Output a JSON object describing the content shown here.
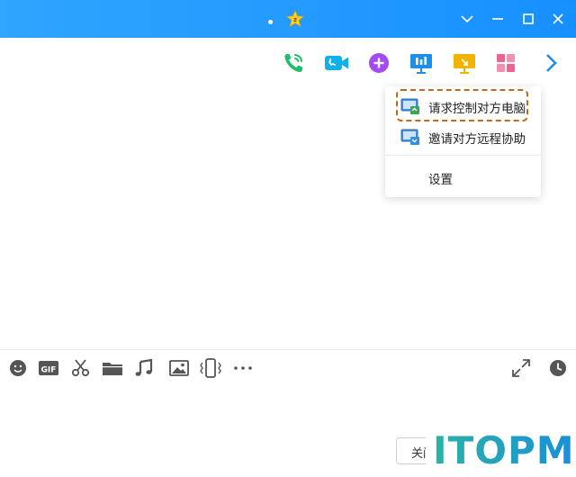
{
  "window": {
    "title_badge_icon": "star-icon",
    "controls": [
      "chevron-down-icon",
      "minimize-icon",
      "maximize-icon",
      "close-icon"
    ]
  },
  "action_bar": {
    "buttons": [
      "voice-call-icon",
      "video-call-icon",
      "add-app-icon",
      "screen-share-icon",
      "remote-assist-icon",
      "apps-grid-icon",
      "chevron-right-icon"
    ],
    "colors": {
      "voice": "#1fbf6b",
      "video": "#10b0e8",
      "add": "#a24bf0",
      "share": "#1d8fe8",
      "remote": "#f2b300",
      "apps": "#f06292",
      "more": "#1d8fe8"
    }
  },
  "dropdown": {
    "items": [
      {
        "label": "请求控制对方电脑",
        "icon": "remote-desktop-icon"
      },
      {
        "label": "邀请对方远程协助",
        "icon": "remote-desktop-icon"
      }
    ],
    "settings_label": "设置"
  },
  "toolbar": {
    "tools": [
      "emoji-icon",
      "gif-icon",
      "scissors-icon",
      "folder-icon",
      "music-icon",
      "image-icon",
      "shake-icon",
      "more-icon"
    ],
    "right_tools": [
      "expand-icon",
      "history-clock-icon"
    ]
  },
  "footer": {
    "close_label": "关闭",
    "watermark": "ITOPM"
  }
}
